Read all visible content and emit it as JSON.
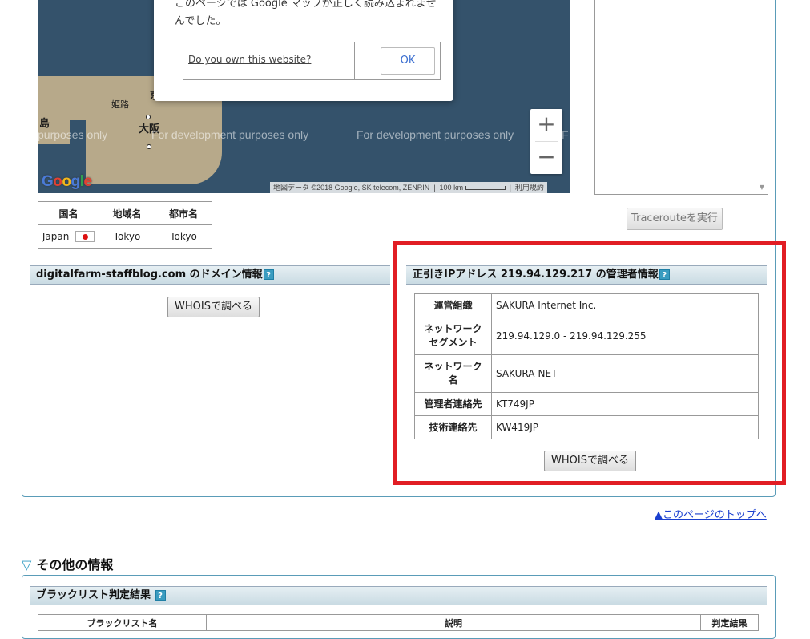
{
  "map": {
    "labels": {
      "himeji": "姫路",
      "osaka": "大阪",
      "island": "島",
      "kyoto_partial": "京"
    },
    "dev_text": "For development purposes only",
    "dev_text_partial": "purposes only",
    "dev_text_edge": "F",
    "google_logo": [
      "G",
      "o",
      "o",
      "g",
      "l",
      "e"
    ],
    "attribution": "地図データ ©2018 Google, SK telecom, ZENRIN",
    "scale": "100 km",
    "terms": "利用規約",
    "zoom_in": "+",
    "zoom_out": "−",
    "colors": {
      "water": "#34526b",
      "land": "#b7a98a"
    }
  },
  "dialog": {
    "message": "このページでは Google マップが正しく読み込まれませんでした。",
    "link": "Do you own this website?",
    "ok": "OK"
  },
  "traceroute": {
    "button": "Tracerouteを実行",
    "scroll_icon": "▼"
  },
  "location": {
    "headers": [
      "国名",
      "地域名",
      "都市名"
    ],
    "country": "Japan",
    "region": "Tokyo",
    "city": "Tokyo"
  },
  "domain_section": {
    "title": "digitalfarm-staffblog.com のドメイン情報",
    "help": "?",
    "whois_button": "WHOISで調べる"
  },
  "admin_section": {
    "title": "正引きIPアドレス 219.94.129.217 の管理者情報",
    "help": "?",
    "rows": [
      {
        "label": "運営組織",
        "value": "SAKURA Internet Inc."
      },
      {
        "label": "ネットワークセグメント",
        "value": "219.94.129.0 - 219.94.129.255"
      },
      {
        "label": "ネットワーク名",
        "value": "SAKURA-NET"
      },
      {
        "label": "管理者連絡先",
        "value": "KT749JP"
      },
      {
        "label": "技術連絡先",
        "value": "KW419JP"
      }
    ],
    "whois_button": "WHOISで調べる",
    "highlight_color": "#e11d24"
  },
  "page_top_link": "▲このページのトップへ",
  "other_info": {
    "title": "その他の情報",
    "triangle": "▽",
    "blacklist_title": "ブラックリスト判定結果",
    "help": "?",
    "headers": [
      "ブラックリスト名",
      "説明",
      "判定結果"
    ]
  }
}
